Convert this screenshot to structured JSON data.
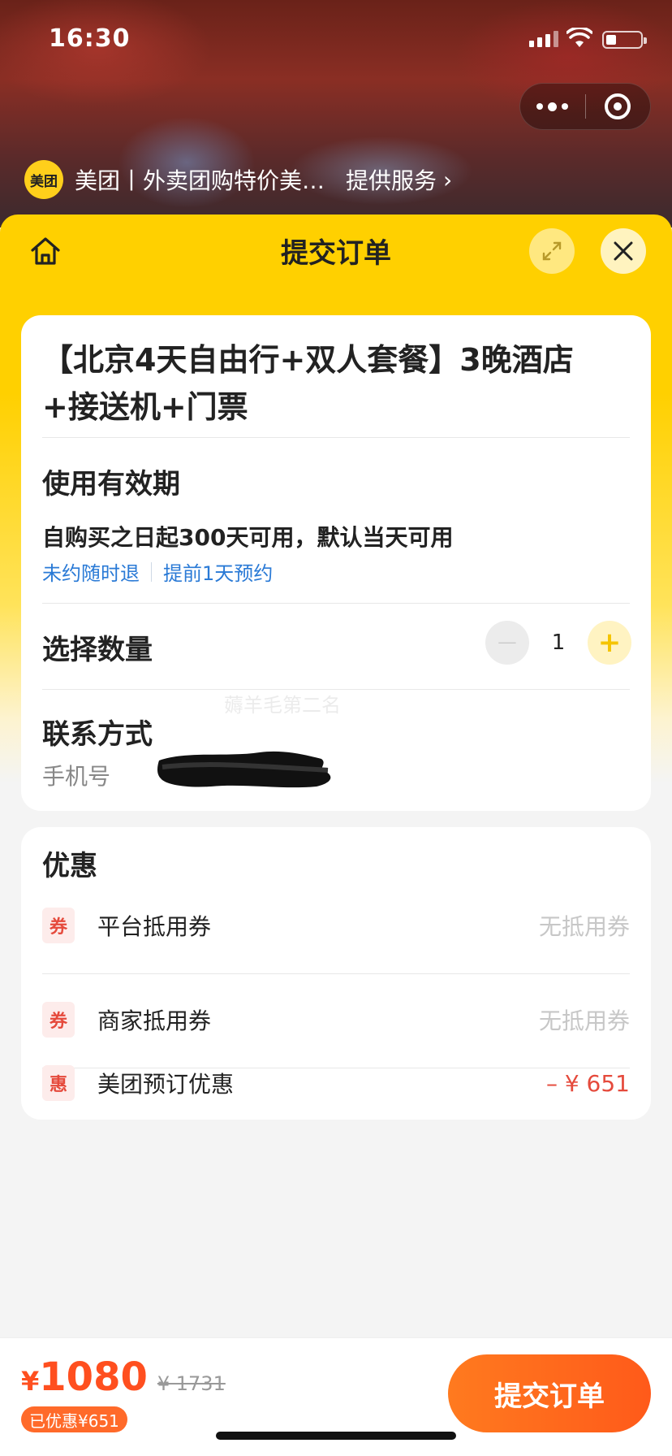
{
  "status_bar": {
    "time": "16:30"
  },
  "service_bar": {
    "logo_text": "美团",
    "app_name": "美团丨外卖团购特价美…",
    "link_label": "提供服务",
    "chevron": "›"
  },
  "header": {
    "title": "提交订单"
  },
  "product": {
    "title": "【北京4天自由行+双人套餐】3晚酒店+接送机+门票",
    "validity_label": "使用有效期",
    "validity_text": "自购买之日起300天可用，默认当天可用",
    "tags": [
      "未约随时退",
      "提前1天预约"
    ],
    "quantity_label": "选择数量",
    "quantity": "1",
    "minus": "−",
    "plus": "+",
    "contact_label": "联系方式",
    "phone_label": "手机号",
    "watermark": "薅羊毛第二名"
  },
  "discounts": {
    "title": "优惠",
    "items": [
      {
        "icon": "券",
        "name": "平台抵用券",
        "value": "无抵用券"
      },
      {
        "icon": "券",
        "name": "商家抵用券",
        "value": "无抵用券"
      },
      {
        "icon": "惠",
        "name": "美团预订优惠",
        "value": "– ¥ 651"
      }
    ]
  },
  "footer": {
    "currency": "¥",
    "price": "1080",
    "original_price": "¥ 1731",
    "saved": "已优惠¥651",
    "submit_label": "提交订单"
  },
  "colors": {
    "brand_yellow": "#ffd000",
    "accent_orange": "#ff5a1a",
    "link_blue": "#2a7ad6",
    "discount_red": "#e54a3c"
  },
  "icons": [
    "home-icon",
    "expand-icon",
    "close-icon",
    "more-icon",
    "target-icon",
    "wifi-icon",
    "battery-icon",
    "signal-icon"
  ]
}
